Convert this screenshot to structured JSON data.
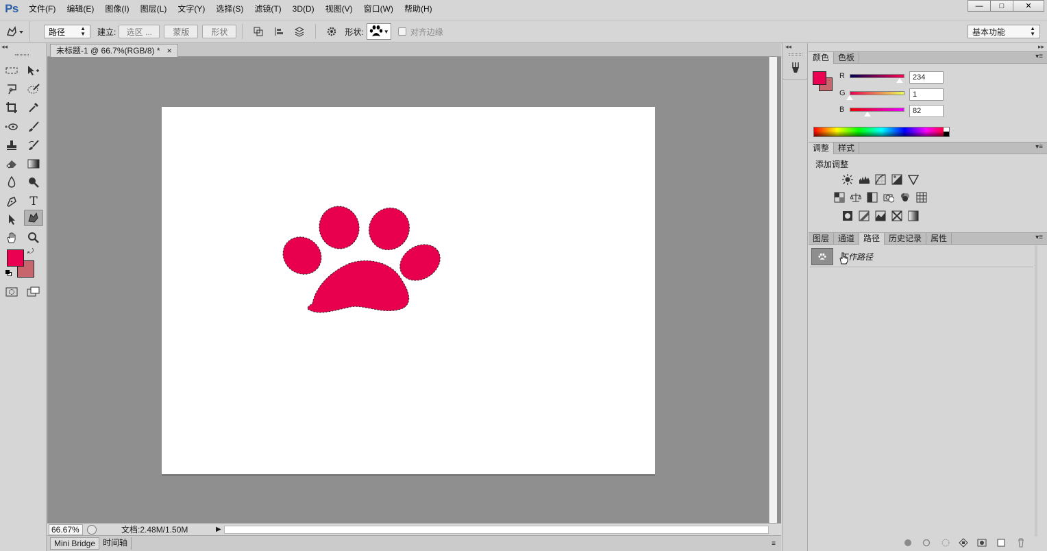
{
  "app": {
    "logo": "Ps"
  },
  "menu": [
    "文件(F)",
    "编辑(E)",
    "图像(I)",
    "图层(L)",
    "文字(Y)",
    "选择(S)",
    "滤镜(T)",
    "3D(D)",
    "视图(V)",
    "窗口(W)",
    "帮助(H)"
  ],
  "window_controls": {
    "minimize": "—",
    "maximize": "□",
    "close": "✕"
  },
  "options": {
    "mode_value": "路径",
    "make_label": "建立:",
    "selection_btn": "选区 ...",
    "mask_btn": "蒙版",
    "shape_btn": "形状",
    "shape_label": "形状:",
    "align_edges_label": "对齐边缘",
    "workspace": "基本功能"
  },
  "document": {
    "tab_title": "未标题-1 @ 66.7%(RGB/8) *",
    "tab_close": "×",
    "shape_fill": "#E8004F"
  },
  "status": {
    "zoom": "66.67%",
    "doc_info": "文档:2.48M/1.50M"
  },
  "bottom_tabs": [
    "Mini Bridge",
    "时间轴"
  ],
  "color_panel": {
    "tabs": [
      "颜色",
      "色板"
    ],
    "r_label": "R",
    "g_label": "G",
    "b_label": "B",
    "r": "234",
    "g": "1",
    "b": "82",
    "fg_color": "#EA0152",
    "bg_color": "#C8666E"
  },
  "adjust_panel": {
    "tabs": [
      "调整",
      "样式"
    ],
    "title": "添加调整"
  },
  "paths_panel": {
    "tabs": [
      "图层",
      "通道",
      "路径",
      "历史记录",
      "属性"
    ],
    "item_name": "工作路径"
  },
  "swatches": {
    "foreground": "#EA0152",
    "background": "#C8666E"
  }
}
